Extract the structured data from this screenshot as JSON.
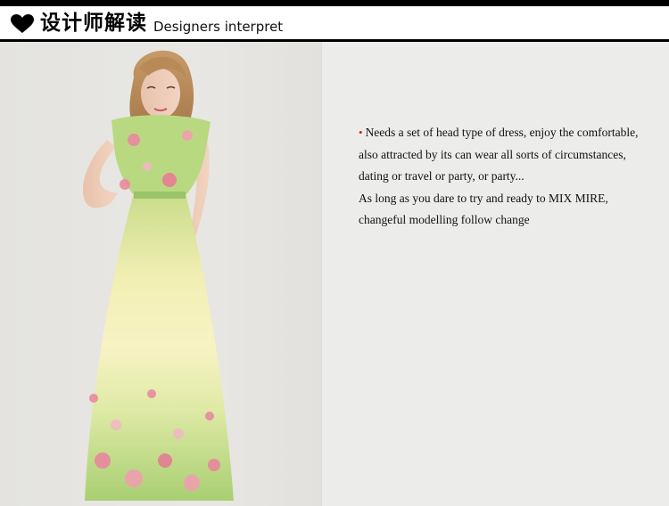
{
  "header": {
    "title_cn": "设计师解读",
    "title_en": "Designers interpret",
    "icon": "heart-icon"
  },
  "photo": {
    "subject": "model-in-floral-maxi-dress"
  },
  "description": {
    "bullet": "•",
    "lines": [
      "Needs a set of head type of dress, enjoy the comfortable,",
      " also attracted by its can wear all sorts of circumstances,",
      "dating or travel or party, or party...",
      "As long as you dare to try and ready to MIX MIRE,",
      "changeful modelling follow change"
    ]
  },
  "colors": {
    "bullet": "#d21a1a",
    "rule": "#000000",
    "background": "#ececea"
  }
}
